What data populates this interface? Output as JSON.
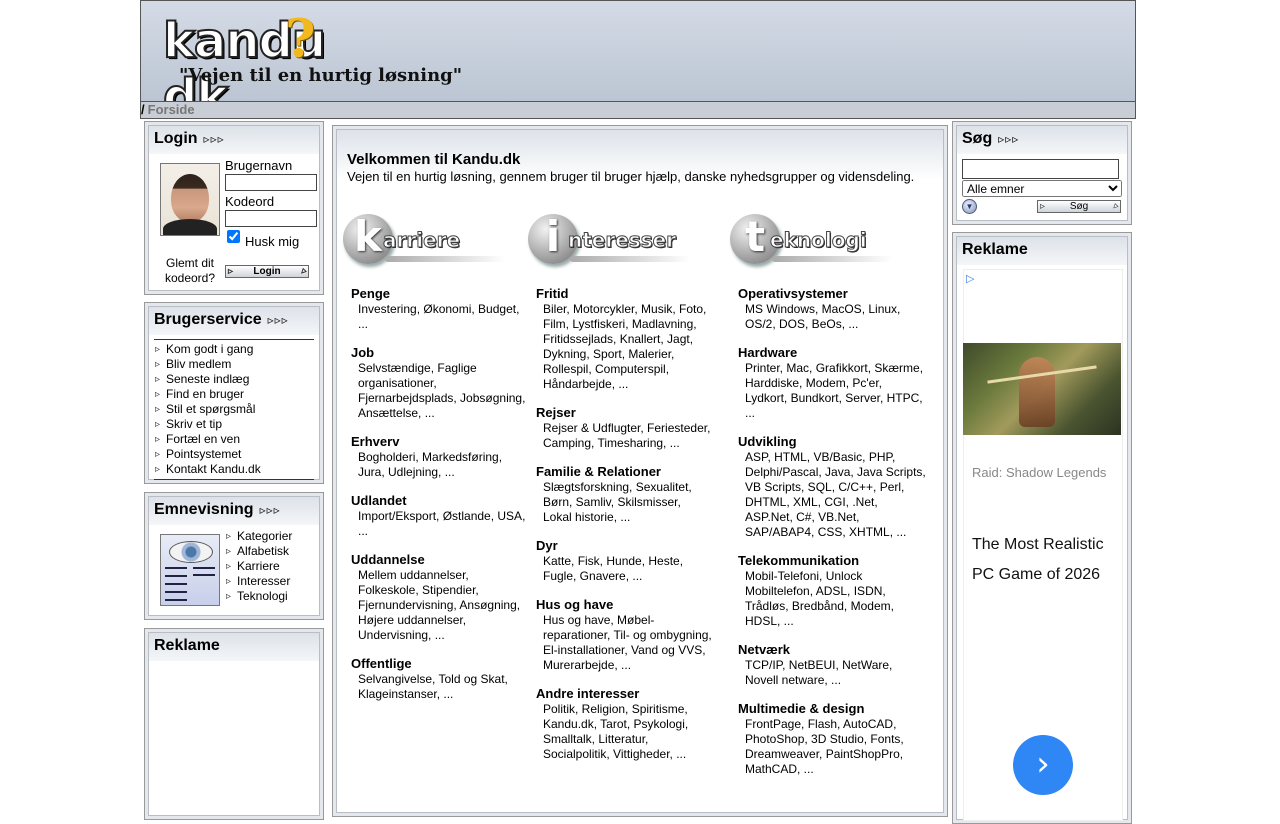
{
  "site": {
    "logo_text": "kandu",
    "logo_q": "?",
    "logo_tld": "dk",
    "logo_tagline": "\"Vejen til en hurtig løsning\""
  },
  "breadcrumb": {
    "separator": "/",
    "current": "Forside"
  },
  "login": {
    "title": "Login",
    "arrows": "▹▹▹",
    "username_label": "Brugernavn",
    "username_value": "",
    "password_label": "Kodeord",
    "password_value": "",
    "remember_label": "Husk mig",
    "remember_checked": true,
    "forgot_label": "Glemt dit kodeord?",
    "login_button": "Login"
  },
  "brugerservice": {
    "title": "Brugerservice",
    "arrows": "▹▹▹",
    "items": [
      "Kom godt i gang",
      "Bliv medlem",
      "Seneste indlæg",
      "Find en bruger",
      "Stil et spørgsmål",
      "Skriv et tip",
      "Fortæl en ven",
      "Pointsystemet",
      "Kontakt Kandu.dk"
    ]
  },
  "emnevisning": {
    "title": "Emnevisning",
    "arrows": "▹▹▹",
    "items": [
      "Kategorier",
      "Alfabetisk",
      "Karriere",
      "Interesser",
      "Teknologi"
    ]
  },
  "left_ad": {
    "title": "Reklame"
  },
  "welcome": {
    "title": "Velkommen til Kandu.dk",
    "subtitle": "Vejen til en hurtig løsning, gennem bruger til bruger hjælp, danske nyhedsgrupper og vidensdeling."
  },
  "columns": [
    {
      "letter": "k",
      "word": "arriere",
      "categories": [
        {
          "title": "Penge",
          "links": "Investering, Økonomi, Budget, ..."
        },
        {
          "title": "Job",
          "links": "Selvstændige, Faglige organisationer, Fjernarbejdsplads, Jobsøgning, Ansættelse, ..."
        },
        {
          "title": "Erhverv",
          "links": "Bogholderi, Markedsføring, Jura, Udlejning, ..."
        },
        {
          "title": "Udlandet",
          "links": "Import/Eksport, Østlande, USA, ..."
        },
        {
          "title": "Uddannelse",
          "links": "Mellem uddannelser, Folkeskole, Stipendier, Fjernundervisning, Ansøgning, Højere uddannelser, Undervisning, ..."
        },
        {
          "title": "Offentlige",
          "links": "Selvangivelse, Told og Skat, Klageinstanser, ..."
        }
      ]
    },
    {
      "letter": "i",
      "word": "nteresser",
      "categories": [
        {
          "title": "Fritid",
          "links": "Biler, Motorcykler, Musik, Foto, Film, Lystfiskeri, Madlavning, Fritidssejlads, Knallert, Jagt, Dykning, Sport, Malerier, Rollespil, Computerspil, Håndarbejde, ..."
        },
        {
          "title": "Rejser",
          "links": "Rejser & Udflugter, Feriesteder, Camping, Timesharing, ..."
        },
        {
          "title": "Familie & Relationer",
          "links": "Slægtsforskning, Sexualitet, Børn, Samliv, Skilsmisser, Lokal historie, ..."
        },
        {
          "title": "Dyr",
          "links": "Katte, Fisk, Hunde, Heste, Fugle, Gnavere, ..."
        },
        {
          "title": "Hus og have",
          "links": "Hus og have, Møbel-reparationer, Til- og ombygning, El-installationer, Vand og VVS, Murerarbejde, ..."
        },
        {
          "title": "Andre interesser",
          "links": "Politik, Religion, Spiritisme, Kandu.dk, Tarot, Psykologi, Smalltalk, Litteratur, Socialpolitik, Vittigheder, ..."
        }
      ]
    },
    {
      "letter": "t",
      "word": "eknologi",
      "categories": [
        {
          "title": "Operativsystemer",
          "links": "MS Windows, MacOS, Linux, OS/2, DOS, BeOs, ..."
        },
        {
          "title": "Hardware",
          "links": "Printer, Mac, Grafikkort, Skærme, Harddiske, Modem, Pc'er, Lydkort, Bundkort, Server, HTPC, ..."
        },
        {
          "title": "Udvikling",
          "links": "ASP, HTML, VB/Basic, PHP, Delphi/Pascal, Java, Java Scripts, VB Scripts, SQL, C/C++, Perl, DHTML, XML, CGI, .Net, ASP.Net, C#, VB.Net, SAP/ABAP4, CSS, XHTML, ..."
        },
        {
          "title": "Telekommunikation",
          "links": "Mobil-Telefoni, Unlock Mobiltelefon, ADSL, ISDN, Trådløs, Bredbånd, Modem, HDSL, ..."
        },
        {
          "title": "Netværk",
          "links": "TCP/IP, NetBEUI, NetWare, Novell netware, ..."
        },
        {
          "title": "Multimedie & design",
          "links": "FrontPage, Flash, AutoCAD, PhotoShop, 3D Studio, Fonts, Dreamweaver, PaintShopPro, MathCAD, ..."
        }
      ]
    }
  ],
  "search": {
    "title": "Søg",
    "arrows": "▹▹▹",
    "query": "",
    "selected_option": "Alle emner",
    "button": "Søg"
  },
  "right_ad": {
    "title": "Reklame",
    "ad_icon": "▷",
    "brand": "Raid: Shadow Legends",
    "headline": "The Most Realistic PC Game of 2026",
    "next_glyph": "›"
  }
}
